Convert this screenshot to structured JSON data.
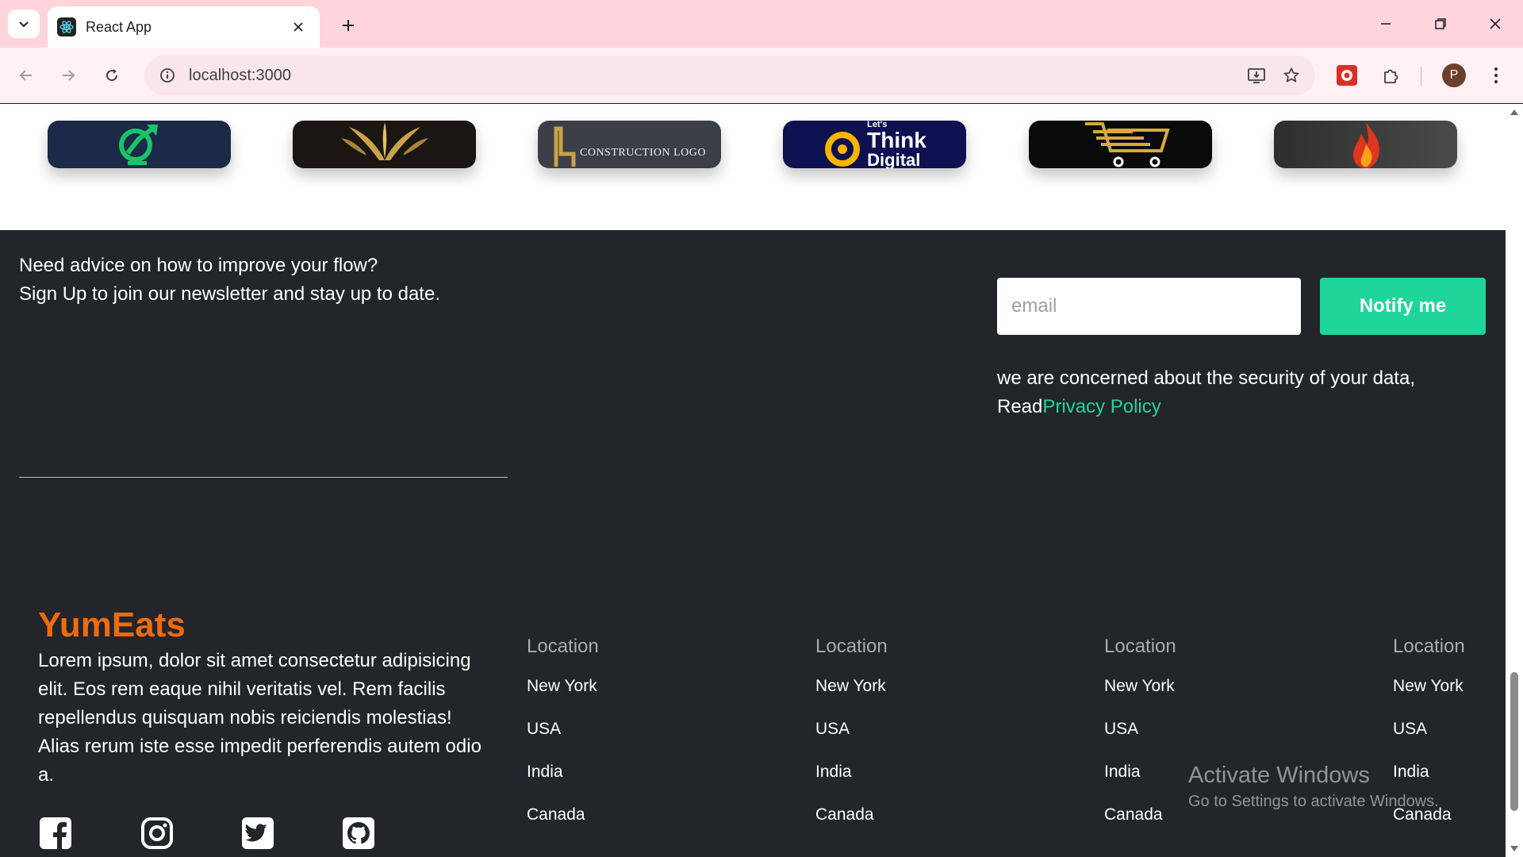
{
  "browser": {
    "tab_title": "React App",
    "url": "localhost:3000",
    "profile_initial": "P"
  },
  "logos": [
    {
      "name": "growth-logo",
      "bg": "#1b2a47"
    },
    {
      "name": "laurel-logo",
      "bg": "#1a1612"
    },
    {
      "name": "construction-logo",
      "bg": "#3b3f47",
      "text": "CONSTRUCTION LOGO"
    },
    {
      "name": "think-digital-logo",
      "bg": "#0e1150",
      "text_top": "Let's",
      "text_main": "Think",
      "text_sub": "Digital"
    },
    {
      "name": "cart-logo",
      "bg": "#0a0a0a"
    },
    {
      "name": "flame-logo",
      "bg": "#3a3a3a"
    }
  ],
  "newsletter": {
    "line1": "Need advice on how to improve your flow?",
    "line2": "Sign Up to join our newsletter and stay up to date.",
    "email_placeholder": "email",
    "email_value": "",
    "button_label": "Notify me",
    "privacy_text": "we are concerned about the security of your data,",
    "privacy_read": "Read",
    "privacy_link": "Privacy Policy"
  },
  "footer": {
    "brand": "YumEats",
    "description": "Lorem ipsum, dolor sit amet consectetur adipisicing elit. Eos rem eaque nihil veritatis vel. Rem facilis repellendus quisquam nobis reiciendis molestias! Alias rerum iste esse impedit perferendis autem odio a.",
    "social": [
      "facebook-icon",
      "instagram-icon",
      "twitter-icon",
      "github-icon"
    ],
    "columns": [
      {
        "heading": "Location",
        "items": [
          "New York",
          "USA",
          "India",
          "Canada"
        ]
      },
      {
        "heading": "Location",
        "items": [
          "New York",
          "USA",
          "India",
          "Canada"
        ]
      },
      {
        "heading": "Location",
        "items": [
          "New York",
          "USA",
          "India",
          "Canada"
        ]
      },
      {
        "heading": "Location",
        "items": [
          "New York",
          "USA",
          "India",
          "Canada"
        ]
      }
    ]
  },
  "watermark": {
    "title": "Activate Windows",
    "subtitle": "Go to Settings to activate Windows."
  },
  "colors": {
    "accent_green": "#1fd59a",
    "brand_orange": "#f06a0f",
    "footer_bg": "#22252a",
    "tabstrip_bg": "#ffd4dd"
  }
}
